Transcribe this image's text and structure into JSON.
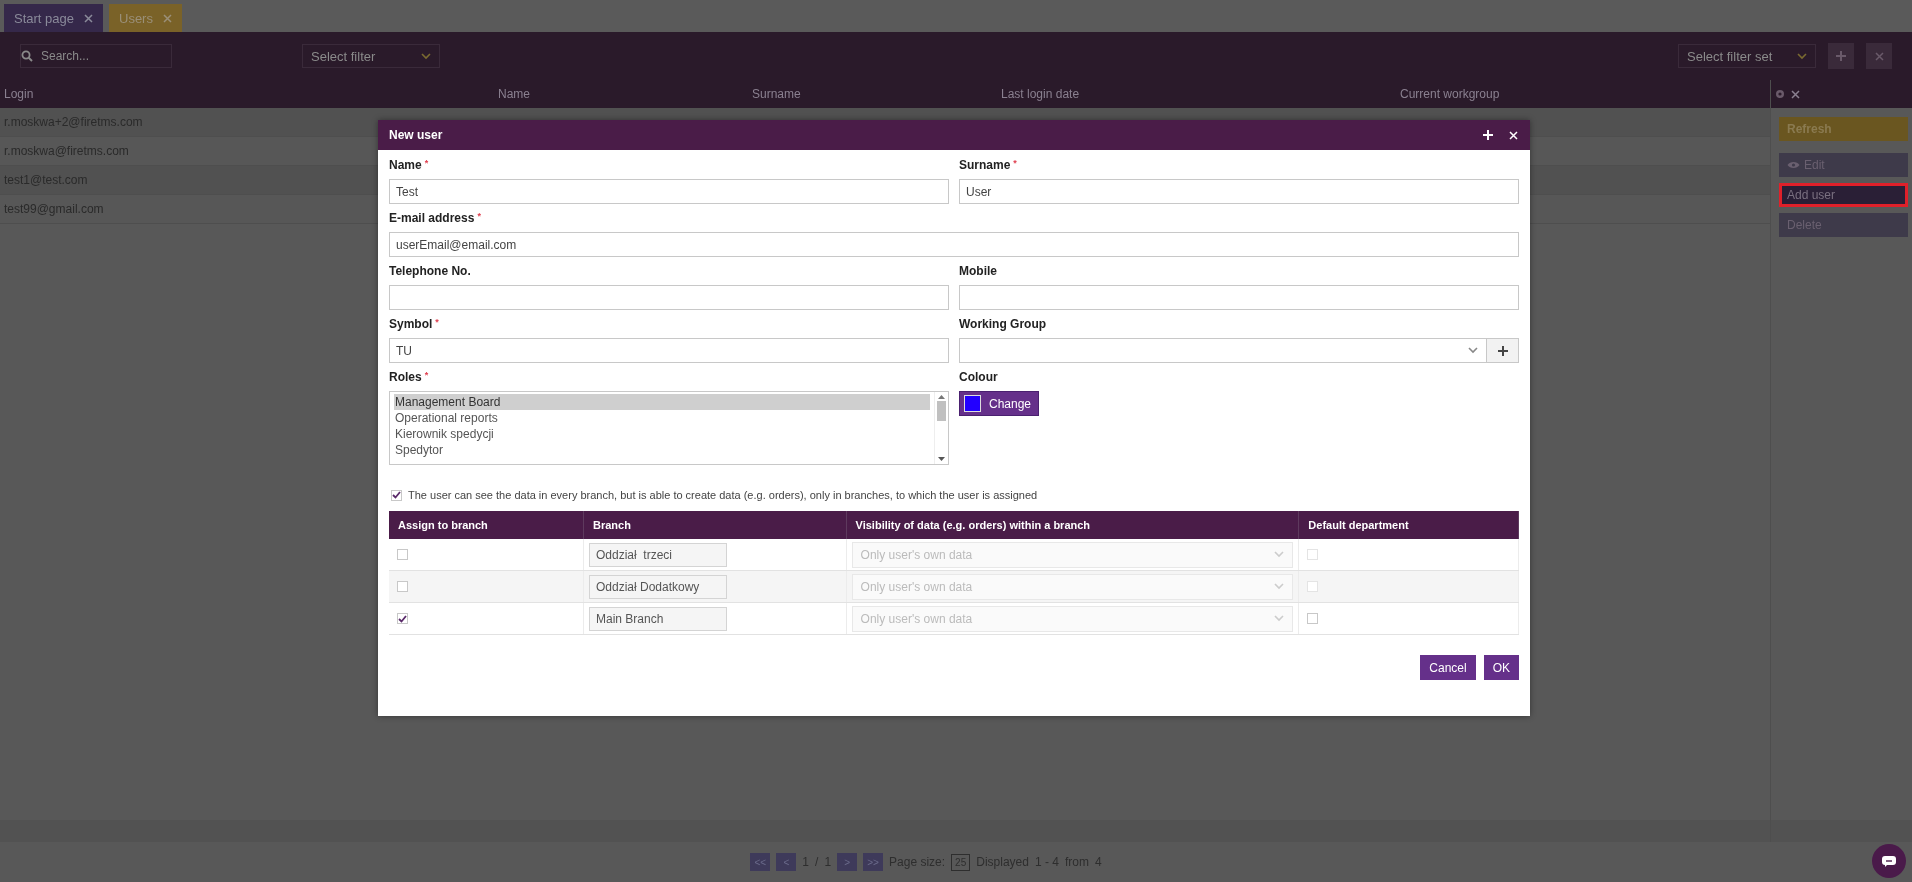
{
  "tabs": [
    {
      "label": "Start page",
      "selected": false
    },
    {
      "label": "Users",
      "selected": true
    }
  ],
  "toolbar": {
    "search_placeholder": "Search...",
    "filter": "Select filter",
    "filter_set": "Select filter set"
  },
  "table": {
    "columns": [
      "Login",
      "Name",
      "Surname",
      "Last login date",
      "Current workgroup"
    ],
    "rows": [
      {
        "login": "r.moskwa+2@firetms.com"
      },
      {
        "login": "r.moskwa@firetms.com"
      },
      {
        "login": "test1@test.com"
      },
      {
        "login": "test99@gmail.com"
      }
    ]
  },
  "actions": [
    {
      "label": "Refresh",
      "kind": "refresh",
      "highlighted": false
    },
    {
      "label": "Edit",
      "kind": "edit",
      "highlighted": false
    },
    {
      "label": "Add user",
      "kind": "plain",
      "highlighted": true
    },
    {
      "label": "Delete",
      "kind": "plain",
      "highlighted": false
    }
  ],
  "pagination": {
    "first": "<<",
    "prev": "<",
    "page": "1",
    "separator": "/",
    "pages": "1",
    "next": ">",
    "last": ">>",
    "page_size_label": "Page size:",
    "page_size": "25",
    "displayed_label": "Displayed",
    "range": "1 - 4",
    "from_label": "from",
    "total": "4"
  },
  "dialog": {
    "title": "New user",
    "fields": [
      {
        "label": "Name",
        "required_mark": "*",
        "value": "Test",
        "kind": "text",
        "wide": false
      },
      {
        "label": "Surname",
        "required_mark": "*",
        "value": "User",
        "kind": "text",
        "wide": false
      },
      {
        "label": "E-mail address",
        "required_mark": "*",
        "value": "userEmail@email.com",
        "kind": "text",
        "wide": true
      },
      {
        "label": "Telephone No.",
        "kind": "text",
        "wide": false
      },
      {
        "label": "Mobile",
        "kind": "text",
        "wide": false
      },
      {
        "label": "Symbol",
        "required_mark": "*",
        "value": "TU",
        "kind": "text",
        "wide": false
      },
      {
        "label": "Working Group",
        "kind": "select",
        "wide": false
      }
    ],
    "roles": {
      "label": "Roles",
      "required_mark": "*",
      "items": [
        {
          "label": "Management Board",
          "selected": true
        },
        {
          "label": "Operational reports",
          "selected": false
        },
        {
          "label": "Kierownik spedycji",
          "selected": false
        },
        {
          "label": "Spedytor",
          "selected": false
        }
      ]
    },
    "colour": {
      "label": "Colour",
      "color": "#2200ff",
      "button": "Change"
    },
    "see_all_branches": {
      "label": "The user can see the data in every branch, but is able to create data (e.g. orders), only in branches, to which the user is assigned",
      "checked": true
    },
    "branches": {
      "columns": [
        "Assign to branch",
        "Branch",
        "Visibility of data (e.g. orders) within a branch",
        "Default department"
      ],
      "rows": [
        {
          "assigned": false,
          "branch": "Oddział  trzeci",
          "visibility": "Only user's own data",
          "default": false
        },
        {
          "assigned": false,
          "branch": "Oddział Dodatkowy",
          "visibility": "Only user's own data",
          "default": false
        },
        {
          "assigned": true,
          "branch": "Main Branch",
          "visibility": "Only user's own data",
          "default": false
        }
      ]
    },
    "buttons": [
      {
        "label": "Cancel"
      },
      {
        "label": "OK"
      }
    ]
  }
}
